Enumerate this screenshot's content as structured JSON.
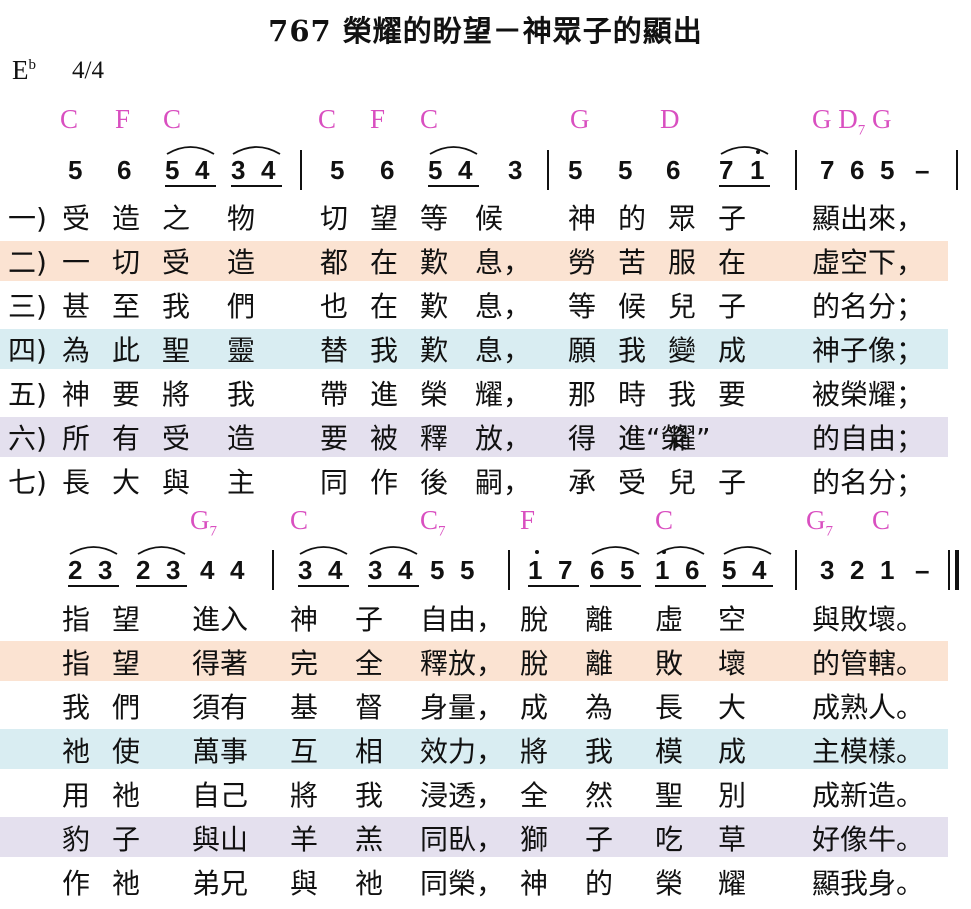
{
  "title": "767 榮耀的盼望－神眾子的顯出",
  "key": "E",
  "key_flat": "b",
  "time_signature": "4/4",
  "colors": {
    "chord": "#d94fc0",
    "verse2_bg": "#fbe3d2",
    "verse4_bg": "#d9edf2",
    "verse6_bg": "#e4e0ee"
  },
  "system1": {
    "chords": [
      {
        "text": "C"
      },
      {
        "text": "F"
      },
      {
        "text": "C"
      },
      {
        "text": "C"
      },
      {
        "text": "F"
      },
      {
        "text": "C"
      },
      {
        "text": "G"
      },
      {
        "text": "D"
      },
      {
        "text": "G D",
        "sub": "7",
        "tail": "G"
      }
    ],
    "notes": [
      "5",
      "6",
      "5",
      "4",
      "3",
      "4",
      "5",
      "6",
      "5",
      "4",
      "3",
      "5",
      "5",
      "6",
      "7",
      "1",
      "7",
      "6",
      "5",
      "–"
    ],
    "verses": [
      {
        "num": "一)",
        "lyrics": [
          "受",
          "造",
          "之",
          "物",
          "切",
          "望",
          "等",
          "候",
          "神",
          "的",
          "眾",
          "子",
          "顯出來，"
        ]
      },
      {
        "num": "二)",
        "lyrics": [
          "一",
          "切",
          "受",
          "造",
          "都",
          "在",
          "歎",
          "息，",
          "勞",
          "苦",
          "服",
          "在",
          "虛空下，"
        ]
      },
      {
        "num": "三)",
        "lyrics": [
          "甚",
          "至",
          "我",
          "們",
          "也",
          "在",
          "歎",
          "息，",
          "等",
          "候",
          "兒",
          "子",
          "的名分；"
        ]
      },
      {
        "num": "四)",
        "lyrics": [
          "為",
          "此",
          "聖",
          "靈",
          "替",
          "我",
          "歎",
          "息，",
          "願",
          "我",
          "變",
          "成",
          "神子像；"
        ]
      },
      {
        "num": "五)",
        "lyrics": [
          "神",
          "要",
          "將",
          "我",
          "帶",
          "進",
          "榮",
          "耀，",
          "那",
          "時",
          "我",
          "要",
          "被榮耀；"
        ]
      },
      {
        "num": "六)",
        "lyrics": [
          "所",
          "有",
          "受",
          "造",
          "要",
          "被",
          "釋",
          "放，",
          "得",
          "進“榮",
          "耀”",
          "",
          "的自由；"
        ]
      },
      {
        "num": "七)",
        "lyrics": [
          "長",
          "大",
          "與",
          "主",
          "同",
          "作",
          "後",
          "嗣，",
          "承",
          "受",
          "兒",
          "子",
          "的名分；"
        ]
      }
    ]
  },
  "system2": {
    "chords": [
      {
        "text": "G",
        "sub": "7"
      },
      {
        "text": "C"
      },
      {
        "text": "C",
        "sub": "7"
      },
      {
        "text": "F"
      },
      {
        "text": "C"
      },
      {
        "text": "G",
        "sub": "7"
      },
      {
        "text": "C"
      }
    ],
    "notes": [
      "2",
      "3",
      "2",
      "3",
      "4",
      "4",
      "3",
      "4",
      "3",
      "4",
      "5",
      "5",
      "1",
      "7",
      "6",
      "5",
      "1",
      "6",
      "5",
      "4",
      "3",
      "2",
      "1",
      "–"
    ],
    "verses": [
      {
        "lyrics": [
          "指",
          "望",
          "進入",
          "神",
          "子",
          "自由，",
          "脫",
          "離",
          "虛",
          "空",
          "與敗壞。"
        ]
      },
      {
        "lyrics": [
          "指",
          "望",
          "得著",
          "完",
          "全",
          "釋放，",
          "脫",
          "離",
          "敗",
          "壞",
          "的管轄。"
        ]
      },
      {
        "lyrics": [
          "我",
          "們",
          "須有",
          "基",
          "督",
          "身量，",
          "成",
          "為",
          "長",
          "大",
          "成熟人。"
        ]
      },
      {
        "lyrics": [
          "祂",
          "使",
          "萬事",
          "互",
          "相",
          "效力，",
          "將",
          "我",
          "模",
          "成",
          "主模樣。"
        ]
      },
      {
        "lyrics": [
          "用",
          "祂",
          "自己",
          "將",
          "我",
          "浸透，",
          "全",
          "然",
          "聖",
          "別",
          "成新造。"
        ]
      },
      {
        "lyrics": [
          "豹",
          "子",
          "與山",
          "羊",
          "羔",
          "同臥，",
          "獅",
          "子",
          "吃",
          "草",
          "好像牛。"
        ]
      },
      {
        "lyrics": [
          "作",
          "祂",
          "弟兄",
          "與",
          "祂",
          "同榮，",
          "神",
          "的",
          "榮",
          "耀",
          "顯我身。"
        ]
      }
    ]
  }
}
